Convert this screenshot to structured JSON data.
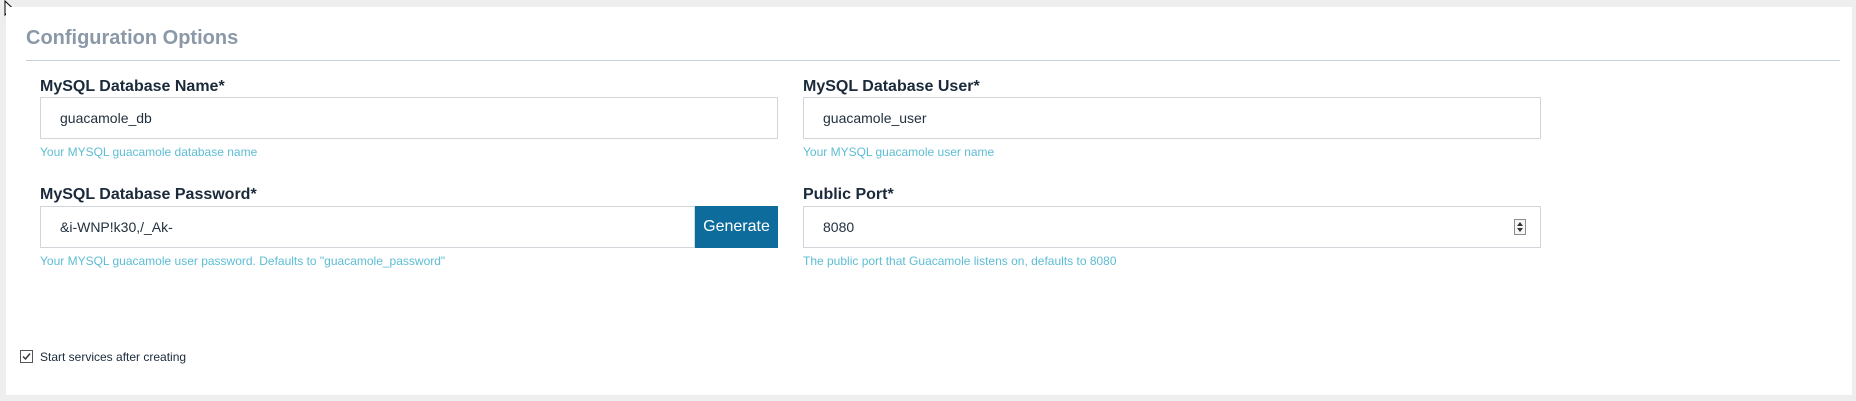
{
  "section": {
    "title": "Configuration Options"
  },
  "fields": {
    "db_name": {
      "label": "MySQL Database Name*",
      "value": "guacamole_db",
      "help": "Your MYSQL guacamole database name"
    },
    "db_user": {
      "label": "MySQL Database User*",
      "value": "guacamole_user",
      "help": "Your MYSQL guacamole user name"
    },
    "db_password": {
      "label": "MySQL Database Password*",
      "value": "&i-WNP!k30,/_Ak-",
      "help": "Your MYSQL guacamole user password. Defaults to \"guacamole_password\"",
      "button_label": "Generate"
    },
    "public_port": {
      "label": "Public Port*",
      "value": "8080",
      "help": "The public port that Guacamole listens on, defaults to 8080"
    }
  },
  "start_services": {
    "label": "Start services after creating",
    "checked": true
  },
  "colors": {
    "accent": "#0e6c9c",
    "help_text": "#5dbdd4",
    "title": "#8a98a8"
  },
  "icons": {
    "cursor": "mouse-pointer-icon",
    "checkbox": "checkmark-icon",
    "spinner": "number-spinner-icon"
  }
}
